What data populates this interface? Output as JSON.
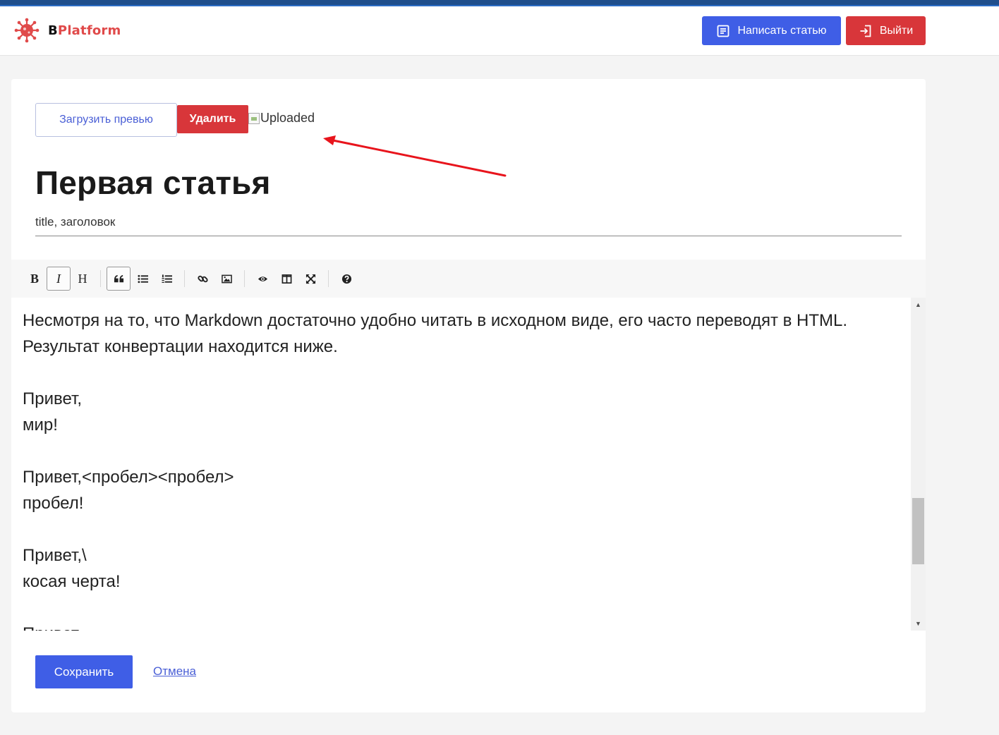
{
  "app": {
    "logo_b": "B",
    "logo_rest": "Platform"
  },
  "header": {
    "write_label": "Написать статью",
    "logout_label": "Выйти"
  },
  "preview": {
    "upload_label": "Загрузить превью",
    "delete_label": "Удалить",
    "image_alt": "Uploaded"
  },
  "article": {
    "title": "Первая статья",
    "subtitle_value": "title, заголовок"
  },
  "toolbar": {
    "bold": "B",
    "italic": "I",
    "heading": "H",
    "icons": [
      "quote-icon",
      "unordered-list-icon",
      "ordered-list-icon",
      "link-icon",
      "image-icon",
      "preview-icon",
      "side-by-side-icon",
      "fullscreen-icon",
      "help-icon"
    ]
  },
  "editor": {
    "content": "Несмотря на то, что Markdown достаточно удобно читать в исходном виде, его часто переводят в HTML. Результат конвертации находится ниже.\n\nПривет,\nмир!\n\nПривет,<пробел><пробел>\nпробел!\n\nПривет,\\\nкосая черта!\n\nПривет,"
  },
  "actions": {
    "save_label": "Сохранить",
    "cancel_label": "Отмена"
  },
  "colors": {
    "primary": "#3f5ee6",
    "danger": "#d8363a",
    "annotation_arrow": "#e8141c"
  }
}
